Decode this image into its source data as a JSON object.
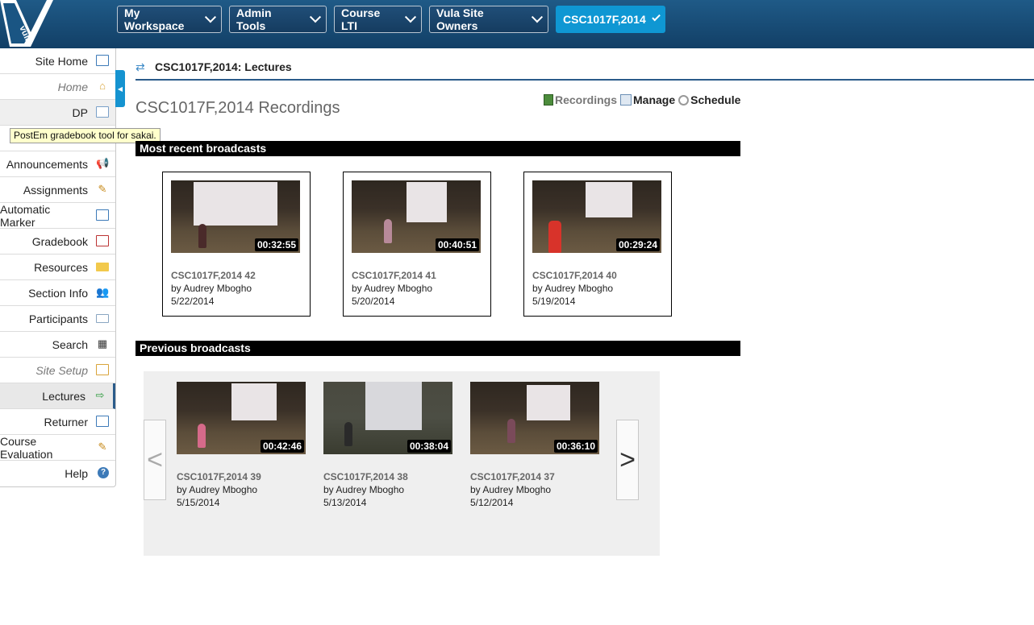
{
  "topnav": {
    "logo_text": "vula",
    "buttons": [
      "My Workspace",
      "Admin Tools",
      "Course LTI",
      "Vula Site Owners",
      "CSC1017F,2014"
    ]
  },
  "sidebar": {
    "items": [
      {
        "label": "Site Home",
        "icon": "window-icon"
      },
      {
        "label": "Home",
        "icon": "house-icon"
      },
      {
        "label": "DP",
        "icon": "gradebook-icon"
      },
      {
        "label": "",
        "icon": "tool-icon"
      },
      {
        "label": "Announcements",
        "icon": "megaphone-icon"
      },
      {
        "label": "Assignments",
        "icon": "pencil-icon"
      },
      {
        "label": "Automatic Marker",
        "icon": "window-icon"
      },
      {
        "label": "Gradebook",
        "icon": "gradebook-icon"
      },
      {
        "label": "Resources",
        "icon": "folder-icon"
      },
      {
        "label": "Section Info",
        "icon": "people-icon"
      },
      {
        "label": "Participants",
        "icon": "card-icon"
      },
      {
        "label": "Search",
        "icon": "binoculars-icon"
      },
      {
        "label": "Site Setup",
        "icon": "setup-icon"
      },
      {
        "label": "Lectures",
        "icon": "lectures-icon"
      },
      {
        "label": "Returner",
        "icon": "window-icon"
      },
      {
        "label": "Course Evaluation",
        "icon": "pencil-icon"
      },
      {
        "label": "Help",
        "icon": "help-icon"
      }
    ],
    "tooltip": "PostEm gradebook tool for sakai."
  },
  "main": {
    "tool_title": "CSC1017F,2014: Lectures",
    "heading": "CSC1017F,2014 Recordings",
    "toolbar": {
      "recordings": "Recordings",
      "manage": "Manage",
      "schedule": "Schedule"
    },
    "recent_header": "Most recent broadcasts",
    "previous_header": "Previous broadcasts",
    "recent": [
      {
        "title": "CSC1017F,2014 42",
        "by": "by Audrey Mbogho",
        "date": "5/22/2014",
        "duration": "00:32:55"
      },
      {
        "title": "CSC1017F,2014 41",
        "by": "by Audrey Mbogho",
        "date": "5/20/2014",
        "duration": "00:40:51"
      },
      {
        "title": "CSC1017F,2014 40",
        "by": "by Audrey Mbogho",
        "date": "5/19/2014",
        "duration": "00:29:24"
      }
    ],
    "previous": [
      {
        "title": "CSC1017F,2014 39",
        "by": "by Audrey Mbogho",
        "date": "5/15/2014",
        "duration": "00:42:46"
      },
      {
        "title": "CSC1017F,2014 38",
        "by": "by Audrey Mbogho",
        "date": "5/13/2014",
        "duration": "00:38:04"
      },
      {
        "title": "CSC1017F,2014 37",
        "by": "by Audrey Mbogho",
        "date": "5/12/2014",
        "duration": "00:36:10"
      }
    ],
    "carousel_prev": "<",
    "carousel_next": ">"
  }
}
